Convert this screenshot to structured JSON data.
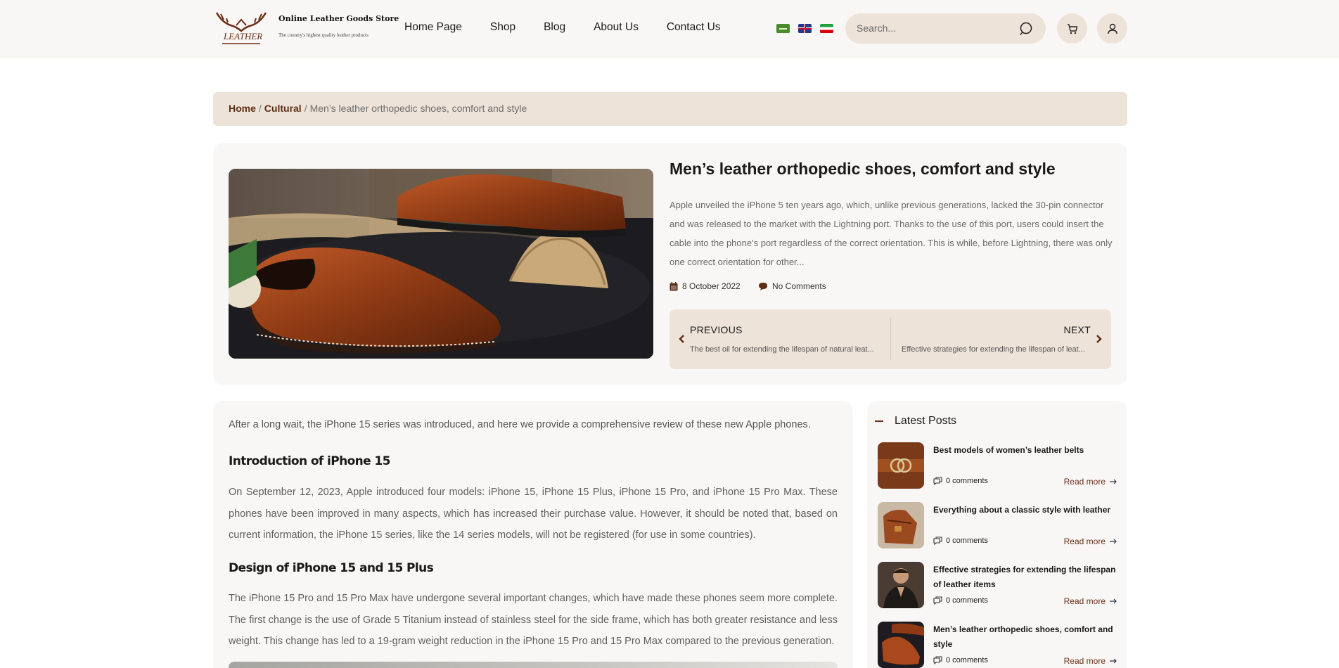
{
  "header": {
    "logo_text": "LEATHER",
    "brand_name": "Online Leather Goods Store",
    "brand_tagline": "The country's highest quality leather products",
    "nav": [
      "Home Page",
      "Shop",
      "Blog",
      "About Us",
      "Contact Us"
    ],
    "search_placeholder": "Search..."
  },
  "breadcrumb": {
    "home": "Home",
    "category": "Cultural",
    "current": "Men’s leather orthopedic shoes, comfort and style"
  },
  "hero": {
    "title": "Men’s leather orthopedic shoes, comfort and style",
    "excerpt": "Apple unveiled the iPhone 5 ten years ago, which, unlike previous generations, lacked the 30-pin connector and was released to the market with the Lightning port. Thanks to the use of this port, users could insert the cable into the phone's port regardless of the correct orientation. This is while, before Lightning, there was only one correct orientation for other...",
    "date": "8 October 2022",
    "comments": "No Comments",
    "previous_label": "PREVIOUS",
    "previous_title": "The best oil for extending the lifespan of natural leat...",
    "next_label": "NEXT",
    "next_title": "Effective strategies for extending the lifespan of leat..."
  },
  "article": {
    "intro": "After a long wait, the iPhone 15 series was introduced, and here we provide a comprehensive review of these new Apple phones.",
    "h1": "Introduction of iPhone 15",
    "p1": "On September 12, 2023, Apple introduced four models: iPhone 15, iPhone 15 Plus, iPhone 15 Pro, and iPhone 15 Pro Max. These phones have been improved in many aspects, which has increased their purchase value. However, it should be noted that, based on current information, the iPhone 15 series, like the 14 series models, will not be registered (for use in some countries).",
    "h2": "Design of iPhone 15 and 15 Plus",
    "p2": "The iPhone 15 Pro and 15 Pro Max have undergone several important changes, which have made these phones seem more complete. The first change is the use of Grade 5 Titanium instead of stainless steel for the side frame, which has both greater resistance and less weight. This change has led to a 19-gram weight reduction in the iPhone 15 Pro and 15 Pro Max compared to the previous generation."
  },
  "sidebar": {
    "title": "Latest Posts",
    "posts": [
      {
        "title": "Best models of women’s leather belts",
        "comments": "0 comments",
        "more": "Read more"
      },
      {
        "title": "Everything about a classic style with leather",
        "comments": "0 comments",
        "more": "Read more"
      },
      {
        "title": "Effective strategies for extending the lifespan of leather items",
        "comments": "0 comments",
        "more": "Read more"
      },
      {
        "title": "Men’s leather orthopedic shoes, comfort and style",
        "comments": "0 comments",
        "more": "Read more"
      }
    ]
  },
  "colors": {
    "accent": "#6b2d14",
    "beige": "#ede3d8",
    "panel": "#f8f7f5"
  }
}
